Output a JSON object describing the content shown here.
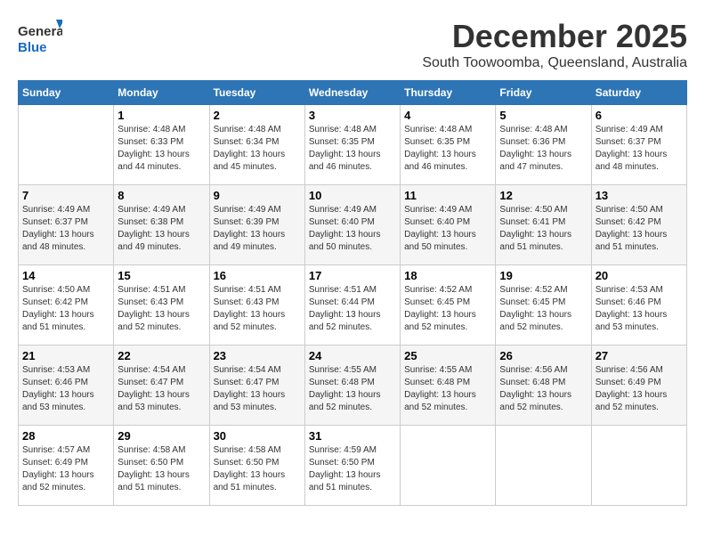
{
  "logo": {
    "line1": "General",
    "line2": "Blue"
  },
  "title": "December 2025",
  "location": "South Toowoomba, Queensland, Australia",
  "headers": [
    "Sunday",
    "Monday",
    "Tuesday",
    "Wednesday",
    "Thursday",
    "Friday",
    "Saturday"
  ],
  "weeks": [
    [
      {
        "day": "",
        "sunrise": "",
        "sunset": "",
        "daylight": ""
      },
      {
        "day": "1",
        "sunrise": "Sunrise: 4:48 AM",
        "sunset": "Sunset: 6:33 PM",
        "daylight": "Daylight: 13 hours and 44 minutes."
      },
      {
        "day": "2",
        "sunrise": "Sunrise: 4:48 AM",
        "sunset": "Sunset: 6:34 PM",
        "daylight": "Daylight: 13 hours and 45 minutes."
      },
      {
        "day": "3",
        "sunrise": "Sunrise: 4:48 AM",
        "sunset": "Sunset: 6:35 PM",
        "daylight": "Daylight: 13 hours and 46 minutes."
      },
      {
        "day": "4",
        "sunrise": "Sunrise: 4:48 AM",
        "sunset": "Sunset: 6:35 PM",
        "daylight": "Daylight: 13 hours and 46 minutes."
      },
      {
        "day": "5",
        "sunrise": "Sunrise: 4:48 AM",
        "sunset": "Sunset: 6:36 PM",
        "daylight": "Daylight: 13 hours and 47 minutes."
      },
      {
        "day": "6",
        "sunrise": "Sunrise: 4:49 AM",
        "sunset": "Sunset: 6:37 PM",
        "daylight": "Daylight: 13 hours and 48 minutes."
      }
    ],
    [
      {
        "day": "7",
        "sunrise": "Sunrise: 4:49 AM",
        "sunset": "Sunset: 6:37 PM",
        "daylight": "Daylight: 13 hours and 48 minutes."
      },
      {
        "day": "8",
        "sunrise": "Sunrise: 4:49 AM",
        "sunset": "Sunset: 6:38 PM",
        "daylight": "Daylight: 13 hours and 49 minutes."
      },
      {
        "day": "9",
        "sunrise": "Sunrise: 4:49 AM",
        "sunset": "Sunset: 6:39 PM",
        "daylight": "Daylight: 13 hours and 49 minutes."
      },
      {
        "day": "10",
        "sunrise": "Sunrise: 4:49 AM",
        "sunset": "Sunset: 6:40 PM",
        "daylight": "Daylight: 13 hours and 50 minutes."
      },
      {
        "day": "11",
        "sunrise": "Sunrise: 4:49 AM",
        "sunset": "Sunset: 6:40 PM",
        "daylight": "Daylight: 13 hours and 50 minutes."
      },
      {
        "day": "12",
        "sunrise": "Sunrise: 4:50 AM",
        "sunset": "Sunset: 6:41 PM",
        "daylight": "Daylight: 13 hours and 51 minutes."
      },
      {
        "day": "13",
        "sunrise": "Sunrise: 4:50 AM",
        "sunset": "Sunset: 6:42 PM",
        "daylight": "Daylight: 13 hours and 51 minutes."
      }
    ],
    [
      {
        "day": "14",
        "sunrise": "Sunrise: 4:50 AM",
        "sunset": "Sunset: 6:42 PM",
        "daylight": "Daylight: 13 hours and 51 minutes."
      },
      {
        "day": "15",
        "sunrise": "Sunrise: 4:51 AM",
        "sunset": "Sunset: 6:43 PM",
        "daylight": "Daylight: 13 hours and 52 minutes."
      },
      {
        "day": "16",
        "sunrise": "Sunrise: 4:51 AM",
        "sunset": "Sunset: 6:43 PM",
        "daylight": "Daylight: 13 hours and 52 minutes."
      },
      {
        "day": "17",
        "sunrise": "Sunrise: 4:51 AM",
        "sunset": "Sunset: 6:44 PM",
        "daylight": "Daylight: 13 hours and 52 minutes."
      },
      {
        "day": "18",
        "sunrise": "Sunrise: 4:52 AM",
        "sunset": "Sunset: 6:45 PM",
        "daylight": "Daylight: 13 hours and 52 minutes."
      },
      {
        "day": "19",
        "sunrise": "Sunrise: 4:52 AM",
        "sunset": "Sunset: 6:45 PM",
        "daylight": "Daylight: 13 hours and 52 minutes."
      },
      {
        "day": "20",
        "sunrise": "Sunrise: 4:53 AM",
        "sunset": "Sunset: 6:46 PM",
        "daylight": "Daylight: 13 hours and 53 minutes."
      }
    ],
    [
      {
        "day": "21",
        "sunrise": "Sunrise: 4:53 AM",
        "sunset": "Sunset: 6:46 PM",
        "daylight": "Daylight: 13 hours and 53 minutes."
      },
      {
        "day": "22",
        "sunrise": "Sunrise: 4:54 AM",
        "sunset": "Sunset: 6:47 PM",
        "daylight": "Daylight: 13 hours and 53 minutes."
      },
      {
        "day": "23",
        "sunrise": "Sunrise: 4:54 AM",
        "sunset": "Sunset: 6:47 PM",
        "daylight": "Daylight: 13 hours and 53 minutes."
      },
      {
        "day": "24",
        "sunrise": "Sunrise: 4:55 AM",
        "sunset": "Sunset: 6:48 PM",
        "daylight": "Daylight: 13 hours and 52 minutes."
      },
      {
        "day": "25",
        "sunrise": "Sunrise: 4:55 AM",
        "sunset": "Sunset: 6:48 PM",
        "daylight": "Daylight: 13 hours and 52 minutes."
      },
      {
        "day": "26",
        "sunrise": "Sunrise: 4:56 AM",
        "sunset": "Sunset: 6:48 PM",
        "daylight": "Daylight: 13 hours and 52 minutes."
      },
      {
        "day": "27",
        "sunrise": "Sunrise: 4:56 AM",
        "sunset": "Sunset: 6:49 PM",
        "daylight": "Daylight: 13 hours and 52 minutes."
      }
    ],
    [
      {
        "day": "28",
        "sunrise": "Sunrise: 4:57 AM",
        "sunset": "Sunset: 6:49 PM",
        "daylight": "Daylight: 13 hours and 52 minutes."
      },
      {
        "day": "29",
        "sunrise": "Sunrise: 4:58 AM",
        "sunset": "Sunset: 6:50 PM",
        "daylight": "Daylight: 13 hours and 51 minutes."
      },
      {
        "day": "30",
        "sunrise": "Sunrise: 4:58 AM",
        "sunset": "Sunset: 6:50 PM",
        "daylight": "Daylight: 13 hours and 51 minutes."
      },
      {
        "day": "31",
        "sunrise": "Sunrise: 4:59 AM",
        "sunset": "Sunset: 6:50 PM",
        "daylight": "Daylight: 13 hours and 51 minutes."
      },
      {
        "day": "",
        "sunrise": "",
        "sunset": "",
        "daylight": ""
      },
      {
        "day": "",
        "sunrise": "",
        "sunset": "",
        "daylight": ""
      },
      {
        "day": "",
        "sunrise": "",
        "sunset": "",
        "daylight": ""
      }
    ]
  ]
}
